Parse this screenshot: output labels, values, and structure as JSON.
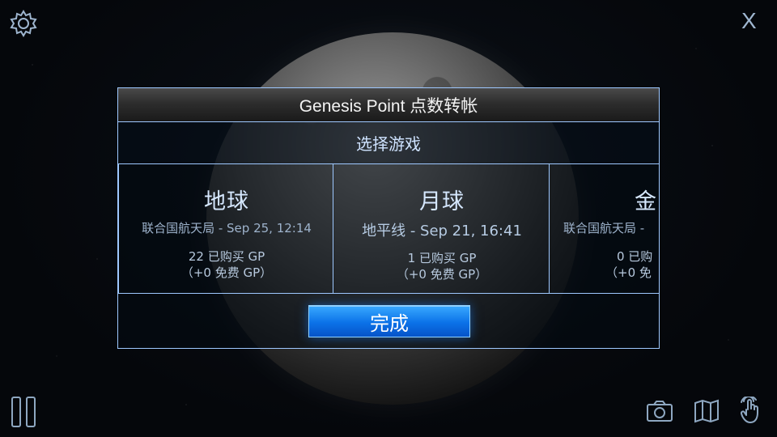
{
  "dialog": {
    "title": "Genesis Point 点数转帐",
    "subtitle": "选择游戏",
    "done_label": "完成"
  },
  "saves": [
    {
      "name": "地球",
      "subtitle": "联合国航天局 - Sep 25, 12:14",
      "gp_line": "22 已购买 GP",
      "free_line": "（+0 免费 GP）"
    },
    {
      "name": "月球",
      "subtitle": "地平线 - Sep 21, 16:41",
      "gp_line": "1 已购买 GP",
      "free_line": "（+0 免费 GP）"
    },
    {
      "name": "金",
      "subtitle": "联合国航天局 -",
      "gp_line": "0 已购",
      "free_line": "（+0 免"
    }
  ],
  "icons": {
    "settings": "gear-icon",
    "close": "close-icon",
    "pause": "pause-icon",
    "camera": "camera-icon",
    "map": "map-icon",
    "touch": "hand-icon"
  },
  "colors": {
    "accent": "#9ec8ff",
    "button": "#0b72e8"
  },
  "close_glyph": "X"
}
